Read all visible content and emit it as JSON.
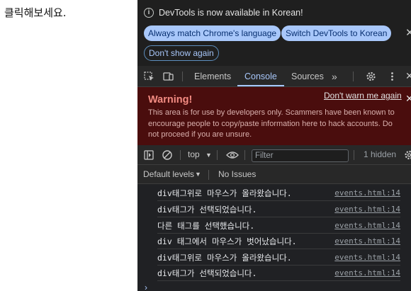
{
  "page": {
    "text": "클릭해보세요."
  },
  "devtools": {
    "info_bar": {
      "message": "DevTools is now available in Korean!",
      "btn_match": "Always match Chrome's language",
      "btn_switch": "Switch DevTools to Korean",
      "btn_dont_show": "Don't show again"
    },
    "tabs": {
      "elements": "Elements",
      "console": "Console",
      "sources": "Sources",
      "more": "»"
    },
    "warning": {
      "title": "Warning!",
      "dont_warn": "Don't warn me again",
      "line1": "This area is for use by developers only. Scammers have been known to",
      "line2": "encourage people to copy/paste information here to hack accounts. Do",
      "line3": "not proceed if you are unsure."
    },
    "filter_bar": {
      "context": "top",
      "filter_placeholder": "Filter",
      "hidden_count": "1 hidden"
    },
    "levels_bar": {
      "default_levels": "Default levels",
      "issues": "No Issues"
    },
    "console_messages": [
      {
        "text": "div태그위로 마우스가 올라왔습니다.",
        "source": "events.html:14"
      },
      {
        "text": "div태그가 선택되었습니다.",
        "source": "events.html:14"
      },
      {
        "text": "다른 태그를 선택했습니다.",
        "source": "events.html:14"
      },
      {
        "text": "div 태그에서 마우스가 벗어났습니다.",
        "source": "events.html:14"
      },
      {
        "text": "div태그위로 마우스가 올라왔습니다.",
        "source": "events.html:14"
      },
      {
        "text": "div태그가 선택되었습니다.",
        "source": "events.html:14"
      }
    ],
    "prompt": "›"
  },
  "colors": {
    "accent": "#a8c7fa",
    "warning_bg": "#4a0d0d",
    "warning_title": "#f28b82",
    "panel_bg": "#202124"
  }
}
